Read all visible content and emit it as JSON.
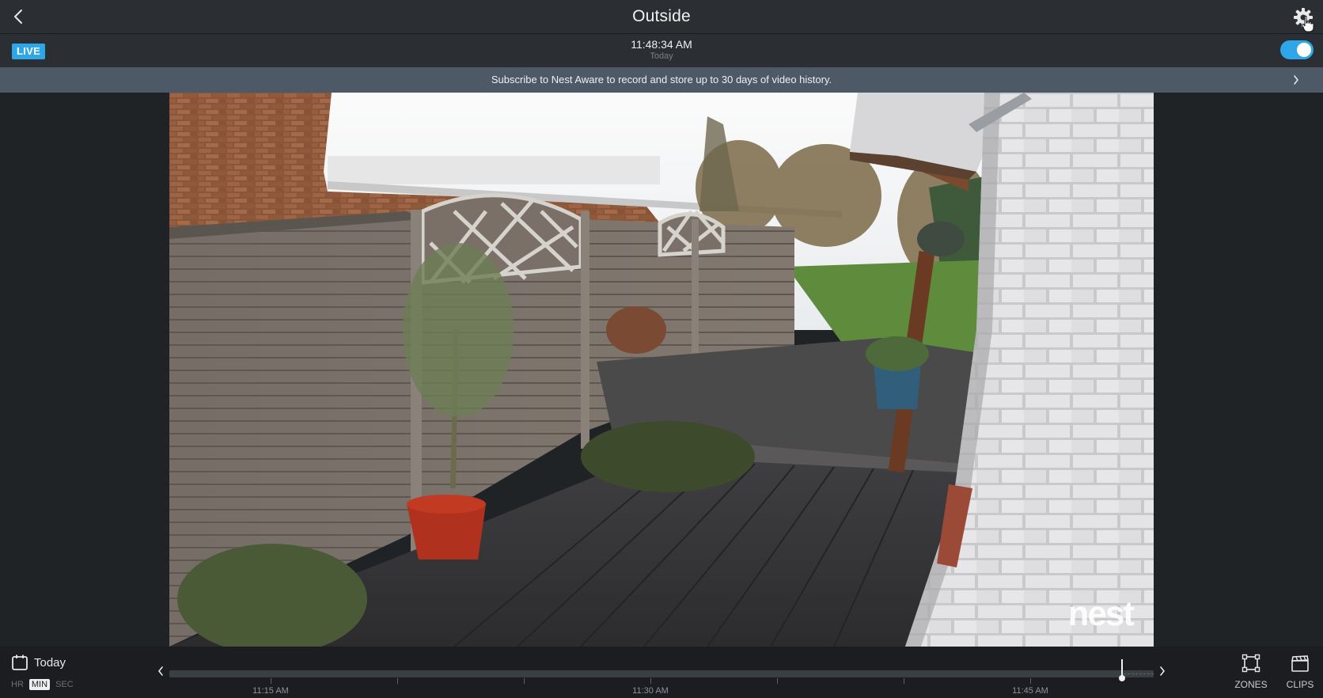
{
  "header": {
    "title": "Outside"
  },
  "status": {
    "live_label": "LIVE",
    "time": "11:48:34 AM",
    "day": "Today",
    "camera_on": true
  },
  "banner": {
    "text": "Subscribe to Nest Aware to record and store up to 30 days of video history."
  },
  "video": {
    "watermark": "nest"
  },
  "footer": {
    "date_label": "Today",
    "scale_options": [
      "HR",
      "MIN",
      "SEC"
    ],
    "scale_selected": "MIN",
    "timeline_labels": [
      "11:15 AM",
      "11:30 AM",
      "11:45 AM"
    ],
    "playhead_time": "11:48:34 AM",
    "zones_label": "ZONES",
    "clips_label": "CLIPS"
  },
  "colors": {
    "accent": "#2ea7e8",
    "banner_bg": "#4d5966",
    "bar_bg": "#2b2f33",
    "footer_bg": "#1b1d20"
  },
  "icons": {
    "back": "chevron-left-icon",
    "settings": "gear-icon",
    "cursor": "hand-pointer-icon",
    "banner_arrow": "chevron-right-icon",
    "calendar": "calendar-icon",
    "timeline_prev": "chevron-left-icon",
    "timeline_next": "chevron-right-icon",
    "zones": "zones-icon",
    "clips": "clapperboard-icon"
  }
}
